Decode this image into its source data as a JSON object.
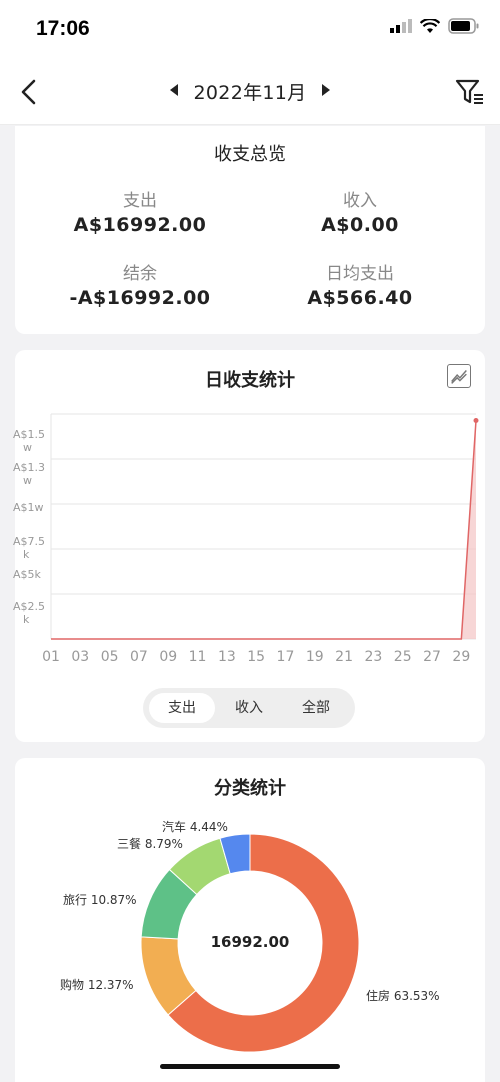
{
  "status": {
    "time": "17:06"
  },
  "nav": {
    "month": "2022年11月"
  },
  "overview": {
    "title": "收支总览",
    "items": [
      {
        "label": "支出",
        "value": "A$16992.00"
      },
      {
        "label": "收入",
        "value": "A$0.00"
      },
      {
        "label": "结余",
        "value": "-A$16992.00"
      },
      {
        "label": "日均支出",
        "value": "A$566.40"
      }
    ]
  },
  "daily": {
    "title": "日收支统计",
    "tabs": [
      "支出",
      "收入",
      "全部"
    ],
    "active_tab": "支出"
  },
  "category": {
    "title": "分类统计",
    "total": "16992.00"
  },
  "colors": {
    "line": "#e06666",
    "accent": "#e8704a"
  },
  "chart_data": [
    {
      "type": "area",
      "title": "日收支统计",
      "x_ticks": [
        "01",
        "03",
        "05",
        "07",
        "09",
        "11",
        "13",
        "15",
        "17",
        "19",
        "21",
        "23",
        "25",
        "27",
        "29"
      ],
      "y_ticks": [
        "A$1.5w",
        "A$1.3w",
        "A$1w",
        "A$7.5k",
        "A$5k",
        "A$2.5k"
      ],
      "ylim": [
        0,
        17500
      ],
      "series": [
        {
          "x": [
            1,
            2,
            3,
            4,
            5,
            6,
            7,
            8,
            9,
            10,
            11,
            12,
            13,
            14,
            15,
            16,
            17,
            18,
            19,
            20,
            21,
            22,
            23,
            24,
            25,
            26,
            27,
            28,
            29,
            30
          ],
          "values": [
            0,
            0,
            0,
            0,
            0,
            0,
            0,
            0,
            0,
            0,
            0,
            0,
            0,
            0,
            0,
            0,
            0,
            0,
            0,
            0,
            0,
            0,
            0,
            0,
            0,
            0,
            0,
            0,
            0,
            16992
          ]
        }
      ]
    },
    {
      "type": "pie",
      "title": "分类统计",
      "slices": [
        {
          "label": "住房",
          "pct": "63.53%",
          "value": 63.53,
          "color": "#ec6e4a"
        },
        {
          "label": "购物",
          "pct": "12.37%",
          "value": 12.37,
          "color": "#f2ae52"
        },
        {
          "label": "旅行",
          "pct": "10.87%",
          "value": 10.87,
          "color": "#5ec187"
        },
        {
          "label": "三餐",
          "pct": "8.79%",
          "value": 8.79,
          "color": "#a3d871"
        },
        {
          "label": "汽车",
          "pct": "4.44%",
          "value": 4.44,
          "color": "#5588ee"
        }
      ]
    }
  ]
}
